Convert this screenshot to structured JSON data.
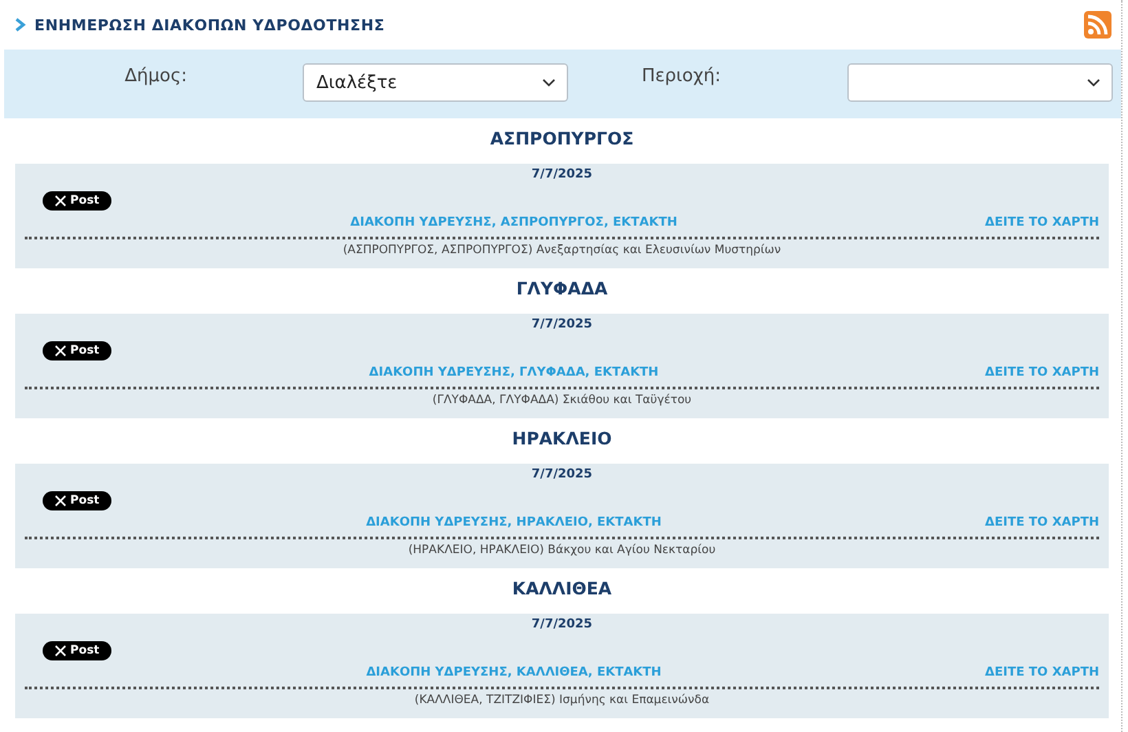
{
  "header": {
    "title": "ΕΝΗΜΕΡΩΣΗ ΔΙΑΚΟΠΩΝ ΥΔΡΟΔΟΤΗΣΗΣ"
  },
  "filters": [
    {
      "label": "Δήμος:",
      "value": "Διαλέξτε"
    },
    {
      "label": "Περιοχή:"
    }
  ],
  "sections": [
    {
      "heading": "ΑΣΠΡΟΠΥΡΓΟΣ",
      "date": "7/7/2025",
      "share": "Post",
      "title": "ΔΙΑΚΟΠΗ ΥΔΡΕΥΣΗΣ, ΑΣΠΡΟΠΥΡΓΟΣ, ΕΚΤΑΚΤΗ",
      "map_link": "ΔΕΙΤΕ ΤΟ ΧΑΡΤΗ",
      "address": "(ΑΣΠΡΟΠΥΡΓΟΣ, ΑΣΠΡΟΠΥΡΓΟΣ) Ανεξαρτησίας και Ελευσινίων Μυστηρίων"
    },
    {
      "heading": "ΓΛΥΦΑΔΑ",
      "date": "7/7/2025",
      "share": "Post",
      "title": "ΔΙΑΚΟΠΗ ΥΔΡΕΥΣΗΣ, ΓΛΥΦΑΔΑ, ΕΚΤΑΚΤΗ",
      "map_link": "ΔΕΙΤΕ ΤΟ ΧΑΡΤΗ",
      "address": "(ΓΛΥΦΑΔΑ, ΓΛΥΦΑΔΑ) Σκιάθου και Ταϋγέτου"
    },
    {
      "heading": "ΗΡΑΚΛΕΙΟ",
      "date": "7/7/2025",
      "share": "Post",
      "title": "ΔΙΑΚΟΠΗ ΥΔΡΕΥΣΗΣ, ΗΡΑΚΛΕΙΟ, ΕΚΤΑΚΤΗ",
      "map_link": "ΔΕΙΤΕ ΤΟ ΧΑΡΤΗ",
      "address": "(ΗΡΑΚΛΕΙΟ, ΗΡΑΚΛΕΙΟ) Βάκχου και Αγίου Νεκταρίου"
    },
    {
      "heading": "ΚΑΛΛΙΘΕΑ",
      "date": "7/7/2025",
      "share": "Post",
      "title": "ΔΙΑΚΟΠΗ ΥΔΡΕΥΣΗΣ, ΚΑΛΛΙΘΕΑ, ΕΚΤΑΚΤΗ",
      "map_link": "ΔΕΙΤΕ ΤΟ ΧΑΡΤΗ",
      "address": "(ΚΑΛΛΙΘΕΑ, ΤΖΙΤΖΙΦΙΕΣ) Ισμήνης και Επαμεινώνδα"
    }
  ]
}
